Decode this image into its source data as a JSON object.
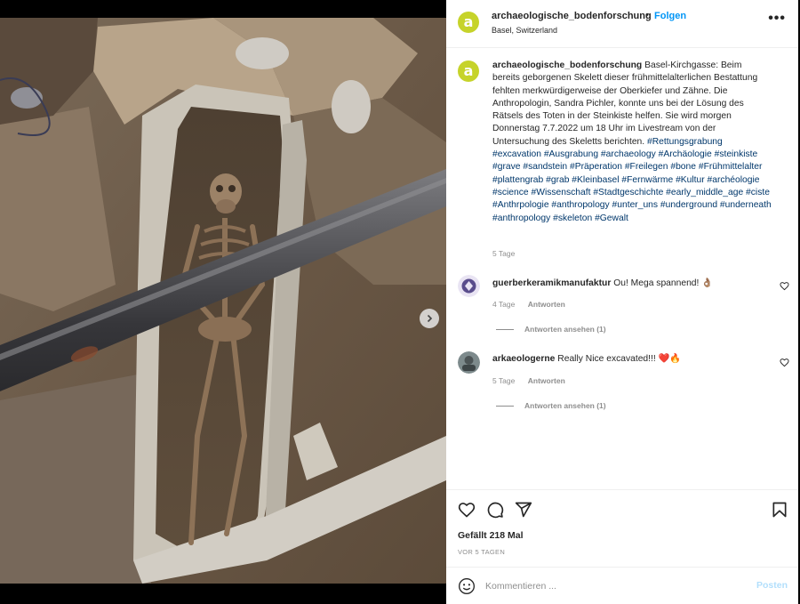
{
  "colors": {
    "accent": "#0095f6",
    "avatar": "#c6d32a",
    "muted": "#8e8e8e",
    "hashtag": "#00376b",
    "like_red": "#ed4956"
  },
  "media": {
    "alt_icon": "chevron-right-icon"
  },
  "header": {
    "avatar_letter": "a",
    "username": "archaeologische_bodenforschung",
    "dot": "•",
    "follow": "Folgen",
    "location": "Basel, Switzerland",
    "more": "•••"
  },
  "caption": {
    "username": "archaeologische_bodenforschung",
    "text": "Basel-Kirchgasse: Beim bereits geborgenen Skelett dieser frühmittelalterlichen Bestattung fehlten merkwürdigerweise der Oberkiefer und Zähne. Die Anthropologin, Sandra Pichler, konnte uns bei der Lösung des Rätsels des Toten in der Steinkiste helfen. Sie wird morgen Donnerstag 7.7.2022 um 18 Uhr im Livestream von der Untersuchung des Skeletts berichten.",
    "hashtags": "#Rettungsgrabung #excavation #Ausgrabung #archaeology #Archäologie #steinkiste #grave #sandstein #Präperation #Freilegen #bone #Frühmittelalter #plattengrab #grab #Kleinbasel #Fernwärme #Kultur #archéologie #science #Wissenschaft #Stadtgeschichte #early_middle_age #ciste #Anthrpologie #anthropology #unter_uns #underground #underneath #anthropology #skeleton #Gewalt",
    "time": "5 Tage"
  },
  "comments": [
    {
      "username": "guerberkeramikmanufaktur",
      "text": "Ou! Mega spannend! 👌🏽",
      "time": "4 Tage",
      "reply": "Antworten",
      "view_replies": "Antworten ansehen (1)"
    },
    {
      "username": "arkaeologerne",
      "text": "Really Nice excavated!!! ❤️🔥",
      "time": "5 Tage",
      "reply": "Antworten",
      "view_replies": "Antworten ansehen (1)"
    }
  ],
  "actions": {
    "likes": "Gefällt 218 Mal",
    "date": "VOR 5 TAGEN"
  },
  "comment_box": {
    "placeholder": "Kommentieren ...",
    "post": "Posten"
  }
}
